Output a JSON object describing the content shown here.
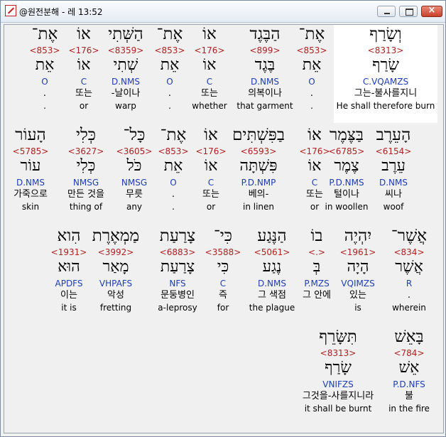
{
  "window": {
    "title": "@원전분해 - 레 13:52",
    "icon": "app-pen-icon",
    "buttons": {
      "minimize": "minimize-icon",
      "maximize": "maximize-icon",
      "close": "×"
    }
  },
  "rows": [
    [
      {
        "heb": "וְשָׂרַף",
        "num": "<8313>",
        "lemma": "שָׂרַף",
        "morph": "C.VQAMZS",
        "kor": "그는-불사를지니",
        "eng": "He shall therefore burn"
      },
      {
        "heb": "אֶת־",
        "num": "<853>",
        "lemma": "אֵת",
        "morph": "O",
        "kor": ".",
        "eng": "."
      },
      {
        "heb": "הַבֶּגֶד",
        "num": "<899>",
        "lemma": "בֶּגֶד",
        "morph": "D.NMS",
        "kor": "의복이나",
        "eng": "that garment"
      },
      {
        "heb": "אוֹ",
        "num": "<176>",
        "lemma": "אוֹ",
        "morph": "C",
        "kor": "또는",
        "eng": "whether"
      },
      {
        "heb": "אֶת־",
        "num": "<853>",
        "lemma": "אֵת",
        "morph": "O",
        "kor": ".",
        "eng": "."
      },
      {
        "heb": "הַשְּׁתִי",
        "num": "<8359>",
        "lemma": "שְׁתִי",
        "morph": "D.NMS",
        "kor": "-날이나",
        "eng": "warp"
      },
      {
        "heb": "אוֹ",
        "num": "<176>",
        "lemma": "אוֹ",
        "morph": "C",
        "kor": "또는",
        "eng": "or"
      },
      {
        "heb": "אֶת־",
        "num": "<853>",
        "lemma": "אֵת",
        "morph": "O",
        "kor": ".",
        "eng": "."
      }
    ],
    [
      {
        "heb": "הָעֵרֶב",
        "num": "<6154>",
        "lemma": "עֵרֶב",
        "morph": "D.NMS",
        "kor": "씨나",
        "eng": "woof"
      },
      {
        "heb": "בַּצֶּמֶר",
        "num": "<6785>",
        "lemma": "צֶמֶר",
        "morph": "P.D.NMS",
        "kor": "털이나",
        "eng": "in woollen"
      },
      {
        "heb": "אוֹ",
        "num": "<176>",
        "lemma": "אוֹ",
        "morph": "C",
        "kor": "또는",
        "eng": "or"
      },
      {
        "heb": "בַפִּשְׁתִּים",
        "num": "<6593>",
        "lemma": "פִּשְׁתָּה",
        "morph": "P.D.NMP",
        "kor": "베의-",
        "eng": "in linen"
      },
      {
        "heb": "אוֹ",
        "num": "<176>",
        "lemma": "אוֹ",
        "morph": "C",
        "kor": "또는",
        "eng": "or"
      },
      {
        "heb": "אֶת־",
        "num": "<853>",
        "lemma": "אֵת",
        "morph": "O",
        "kor": ".",
        "eng": "."
      },
      {
        "heb": "כָּל־",
        "num": "<3605>",
        "lemma": "כֹּל",
        "morph": "NMSG",
        "kor": "무릇",
        "eng": "any"
      },
      {
        "heb": "כְּלִי",
        "num": "<3627>",
        "lemma": "כְּלִי",
        "morph": "NMSG",
        "kor": "만든 것을",
        "eng": "thing of"
      },
      {
        "heb": "הָעוֹר",
        "num": "<5785>",
        "lemma": "עוֹר",
        "morph": "D.NMS",
        "kor": "가죽으로",
        "eng": "skin"
      }
    ],
    [
      {
        "heb": "אֲשֶׁר־",
        "num": "<834>",
        "lemma": "אֲשֶׁר",
        "morph": "R",
        "kor": ".",
        "eng": "wherein"
      },
      {
        "heb": "יִהְיֶה",
        "num": "<1961>",
        "lemma": "הָיָה",
        "morph": "VQIMZS",
        "kor": "있는",
        "eng": "is"
      },
      {
        "heb": "בוֹ",
        "num": "<.>",
        "lemma": "בְּ",
        "morph": "P.MZS",
        "kor": "그 안에",
        "eng": ""
      },
      {
        "heb": "הַנֶּגַע",
        "num": "<5061>",
        "lemma": "נֶגַע",
        "morph": "D.NMS",
        "kor": "그 색점",
        "eng": "the plague"
      },
      {
        "heb": "כִּי־",
        "num": "<3588>",
        "lemma": "כִּי",
        "morph": "C",
        "kor": "즉",
        "eng": "for"
      },
      {
        "heb": "צָרַעַת",
        "num": "<6883>",
        "lemma": "צָרַעַת",
        "morph": "NFS",
        "kor": "문둥병인",
        "eng": "a-leprosy"
      },
      {
        "heb": "מַמְאֶרֶת",
        "num": "<3992>",
        "lemma": "מָאַר",
        "morph": "VHPAFS",
        "kor": "악성",
        "eng": "fretting"
      },
      {
        "heb": "הִוא",
        "num": "<1931>",
        "lemma": "הוּא",
        "morph": "APDFS",
        "kor": "이는",
        "eng": "it is"
      }
    ],
    [
      {
        "heb": "בָּאֵשׁ",
        "num": "<784>",
        "lemma": "אֵשׁ",
        "morph": "P.D.NFS",
        "kor": "불",
        "eng": "in the fire"
      },
      {
        "heb": "תִּשָּׂרֵף",
        "num": "<8313>",
        "lemma": "שָׂרַף",
        "morph": "VNIFZS",
        "kor": "그것을-사를지니라",
        "eng": "it shall be burnt"
      }
    ]
  ]
}
